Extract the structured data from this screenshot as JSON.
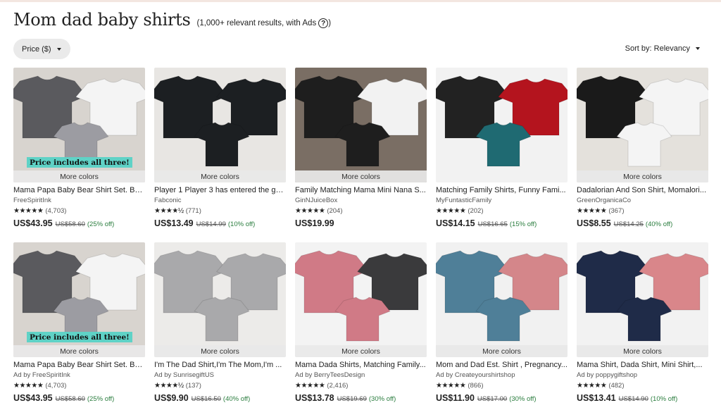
{
  "search": {
    "title": "Mom dad baby shirts",
    "result_count": "(1,000+ relevant results, with Ads",
    "close_paren": ")",
    "help_glyph": "?"
  },
  "filters": {
    "price_label": "Price ($)"
  },
  "sort": {
    "label": "Sort by: Relevancy"
  },
  "more_colors": "More colors",
  "banner_text": "Price includes all three!",
  "products": [
    {
      "title": "Mama Papa Baby Bear Shirt Set. Ba...",
      "shop": "FreeSpiritInk",
      "stars": "★★★★★",
      "reviews": "(4,703)",
      "price": "US$43.95",
      "original": "US$58.60",
      "discount": "(25% off)",
      "more_colors": true,
      "banner": true,
      "bg": "#d8d4cf",
      "shirts": [
        "#5a5a5e",
        "#f4f4f4",
        "#9c9ca2"
      ]
    },
    {
      "title": "Player 1 Player 3 has entered the ga...",
      "shop": "Fabconic",
      "stars": "★★★★½",
      "reviews": "(771)",
      "price": "US$13.49",
      "original": "US$14.99",
      "discount": "(10% off)",
      "more_colors": true,
      "banner": false,
      "bg": "#e8e6e3",
      "shirts": [
        "#1c1f22",
        "#1c1f22",
        "#1c1f22"
      ]
    },
    {
      "title": "Family Matching Mama Mini Nana S...",
      "shop": "GinNJuiceBox",
      "stars": "★★★★★",
      "reviews": "(204)",
      "price": "US$19.99",
      "original": "",
      "discount": "",
      "more_colors": true,
      "banner": false,
      "bg": "#7a6e64",
      "shirts": [
        "#1e1e1e",
        "#f2f2f2",
        "#1e1e1e"
      ]
    },
    {
      "title": "Matching Family Shirts, Funny Fami...",
      "shop": "MyFuntasticFamily",
      "stars": "★★★★★",
      "reviews": "(202)",
      "price": "US$14.15",
      "original": "US$16.65",
      "discount": "(15% off)",
      "more_colors": false,
      "banner": false,
      "bg": "#f2f2f2",
      "shirts": [
        "#222222",
        "#b4141e",
        "#1f6a72"
      ]
    },
    {
      "title": "Dadalorian And Son Shirt, Momalori...",
      "shop": "GreenOrganicaCo",
      "stars": "★★★★★",
      "reviews": "(367)",
      "price": "US$8.55",
      "original": "US$14.25",
      "discount": "(40% off)",
      "more_colors": true,
      "banner": false,
      "bg": "#e4e1dc",
      "shirts": [
        "#1a1a1a",
        "#f4f4f4",
        "#f4f4f4"
      ]
    },
    {
      "title": "Mama Papa Baby Bear Shirt Set. Ba...",
      "shop": "Ad by FreeSpiritInk",
      "stars": "★★★★★",
      "reviews": "(4,703)",
      "price": "US$43.95",
      "original": "US$58.60",
      "discount": "(25% off)",
      "more_colors": true,
      "banner": true,
      "bg": "#d8d4cf",
      "shirts": [
        "#5a5a5e",
        "#f4f4f4",
        "#9c9ca2"
      ]
    },
    {
      "title": "I'm The Dad Shirt,I'm The Mom,I'm ...",
      "shop": "Ad by SunrisegiftUS",
      "stars": "★★★★½",
      "reviews": "(137)",
      "price": "US$9.90",
      "original": "US$16.50",
      "discount": "(40% off)",
      "more_colors": true,
      "banner": false,
      "bg": "#ecebe9",
      "shirts": [
        "#a9a9ab",
        "#a9a9ab",
        "#a9a9ab"
      ]
    },
    {
      "title": "Mama Dada Shirts, Matching Family...",
      "shop": "Ad by BerryTeesDesign",
      "stars": "★★★★★",
      "reviews": "(2,416)",
      "price": "US$13.78",
      "original": "US$19.69",
      "discount": "(30% off)",
      "more_colors": true,
      "banner": false,
      "bg": "#f3f3f3",
      "shirts": [
        "#d07a86",
        "#3a3a3c",
        "#d07a86"
      ]
    },
    {
      "title": "Mom and Dad Est. Shirt , Pregnancy...",
      "shop": "Ad by Createyourshirtshop",
      "stars": "★★★★★",
      "reviews": "(866)",
      "price": "US$11.90",
      "original": "US$17.00",
      "discount": "(30% off)",
      "more_colors": true,
      "banner": false,
      "bg": "#f1f1f1",
      "shirts": [
        "#4f7f98",
        "#d4868a",
        "#4f7f98"
      ]
    },
    {
      "title": "Mama Shirt, Dada Shirt, Mini Shirt,...",
      "shop": "Ad by poppygiftshop",
      "stars": "★★★★★",
      "reviews": "(482)",
      "price": "US$13.41",
      "original": "US$14.90",
      "discount": "(10% off)",
      "more_colors": true,
      "banner": false,
      "bg": "#f2f2f2",
      "shirts": [
        "#1f2b48",
        "#d9868a",
        "#1f2b48"
      ]
    }
  ]
}
